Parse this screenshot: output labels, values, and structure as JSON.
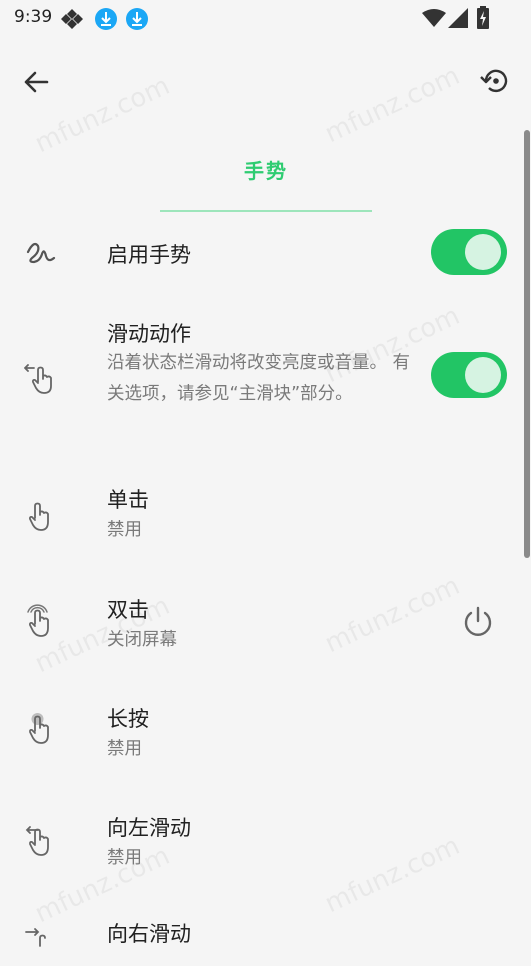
{
  "status_bar": {
    "time": "9:39",
    "icons": [
      "tidal-app-icon",
      "download-icon",
      "download-icon",
      "wifi-icon",
      "cell-signal-icon",
      "battery-icon"
    ]
  },
  "app_bar": {
    "icons": [
      "back-arrow-icon",
      "restore-icon"
    ]
  },
  "page": {
    "title": "手势",
    "accent_color": "#2ecc71",
    "toggle_color": "#22c565"
  },
  "settings": [
    {
      "title": "启用手势",
      "icon": "gesture-squiggle-icon",
      "toggle_on": true
    },
    {
      "title": "滑动动作",
      "subtitle": "沿着状态栏滑动将改变亮度或音量。 有关选项，请参见“主滑块”部分。",
      "icon": "swipe-hand-icon",
      "toggle_on": true
    },
    {
      "title": "单击",
      "subtitle": "禁用",
      "icon": "tap-hand-icon"
    },
    {
      "title": "双击",
      "subtitle": "关闭屏幕",
      "icon": "double-tap-hand-icon",
      "action_icon": "power-icon"
    },
    {
      "title": "长按",
      "subtitle": "禁用",
      "icon": "long-press-hand-icon"
    },
    {
      "title": "向左滑动",
      "subtitle": "禁用",
      "icon": "swipe-left-hand-icon"
    },
    {
      "title": "向右滑动",
      "icon": "swipe-right-hand-icon"
    }
  ]
}
